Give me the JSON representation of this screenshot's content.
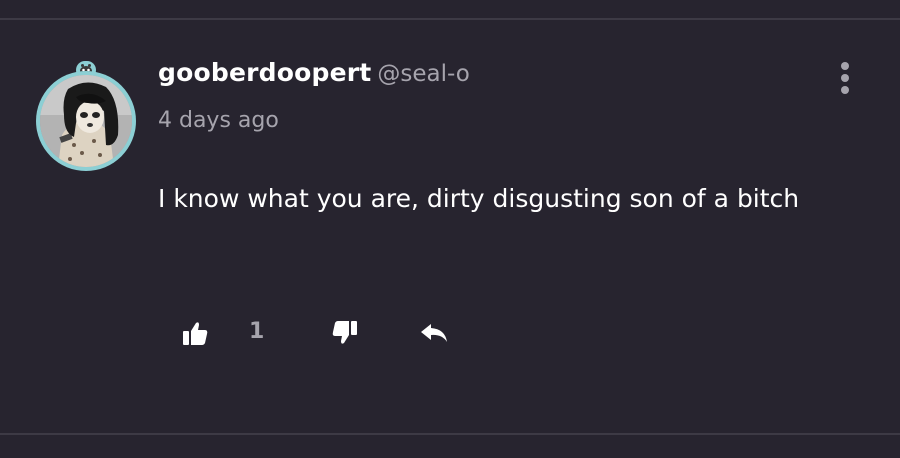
{
  "comment": {
    "username": "gooberdoopert",
    "handle": "@seal-o",
    "time": "4 days ago",
    "text": "I know what you are, dirty disgusting son of a bitch",
    "likes": "1"
  },
  "icons": {
    "like": "thumbs-up-icon",
    "dislike": "thumbs-down-icon",
    "reply": "reply-arrow-icon",
    "menu": "vertical-ellipsis-icon"
  },
  "colors": {
    "background": "#27242f",
    "avatar_ring": "#8ccfd4",
    "muted_text": "#a6a4ad"
  }
}
